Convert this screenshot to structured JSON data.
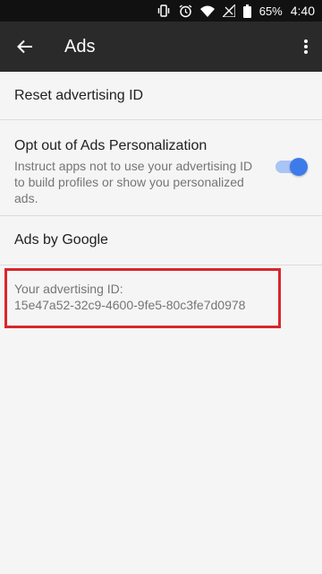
{
  "status_bar": {
    "battery_text": "65%",
    "time": "4:40",
    "icons": [
      "vibrate-icon",
      "alarm-icon",
      "wifi-icon",
      "signal-icon",
      "battery-icon"
    ]
  },
  "app_bar": {
    "title": "Ads",
    "back_icon": "arrow-back-icon",
    "menu_icon": "more-vert-icon"
  },
  "settings": {
    "reset_label": "Reset advertising ID",
    "opt_out": {
      "title": "Opt out of Ads Personalization",
      "summary": "Instruct apps not to use your advertising ID to build profiles or show you personalized ads.",
      "enabled": true
    },
    "ads_by_google_label": "Ads by Google",
    "ad_id": {
      "label": "Your advertising ID:",
      "value": "15e47a52-32c9-4600-9fe5-80c3fe7d0978"
    }
  },
  "colors": {
    "accent": "#3e7bea",
    "highlight": "#d9262c",
    "app_bar": "#2a2a2a"
  }
}
